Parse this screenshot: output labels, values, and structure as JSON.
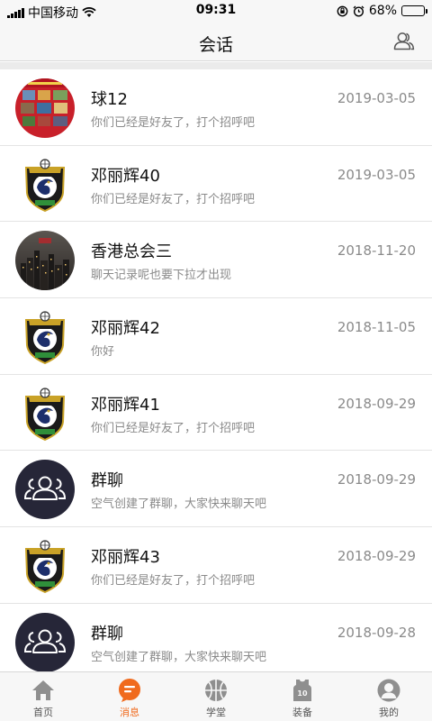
{
  "status_bar": {
    "carrier": "中国移动",
    "time": "09:31",
    "battery": "68%",
    "battery_level": 0.68
  },
  "header": {
    "title": "会话",
    "contacts_icon": "contacts-icon"
  },
  "conversations": [
    {
      "name": "球12",
      "message": "你们已经是好友了，打个招呼吧",
      "date": "2019-03-05",
      "avatar": "photo-red"
    },
    {
      "name": "邓丽辉40",
      "message": "你们已经是好友了，打个招呼吧",
      "date": "2019-03-05",
      "avatar": "dragon-badge"
    },
    {
      "name": "香港总会三",
      "message": "聊天记录呢也要下拉才出现",
      "date": "2018-11-20",
      "avatar": "city-night"
    },
    {
      "name": "邓丽辉42",
      "message": "你好",
      "date": "2018-11-05",
      "avatar": "dragon-badge"
    },
    {
      "name": "邓丽辉41",
      "message": "你们已经是好友了，打个招呼吧",
      "date": "2018-09-29",
      "avatar": "dragon-badge"
    },
    {
      "name": "群聊",
      "message": "空气创建了群聊，大家快来聊天吧",
      "date": "2018-09-29",
      "avatar": "group-icon"
    },
    {
      "name": "邓丽辉43",
      "message": "你们已经是好友了，打个招呼吧",
      "date": "2018-09-29",
      "avatar": "dragon-badge"
    },
    {
      "name": "群聊",
      "message": "空气创建了群聊，大家快来聊天吧",
      "date": "2018-09-28",
      "avatar": "group-icon"
    }
  ],
  "tabs": [
    {
      "label": "首页",
      "icon": "home-icon"
    },
    {
      "label": "消息",
      "icon": "message-icon",
      "active": true
    },
    {
      "label": "学堂",
      "icon": "basketball-icon"
    },
    {
      "label": "装备",
      "icon": "jersey-icon",
      "icon_text": "10"
    },
    {
      "label": "我的",
      "icon": "profile-icon"
    }
  ],
  "colors": {
    "accent": "#f06a1d",
    "group_avatar_bg": "#262638",
    "tab_icon": "#8f8f8f"
  }
}
